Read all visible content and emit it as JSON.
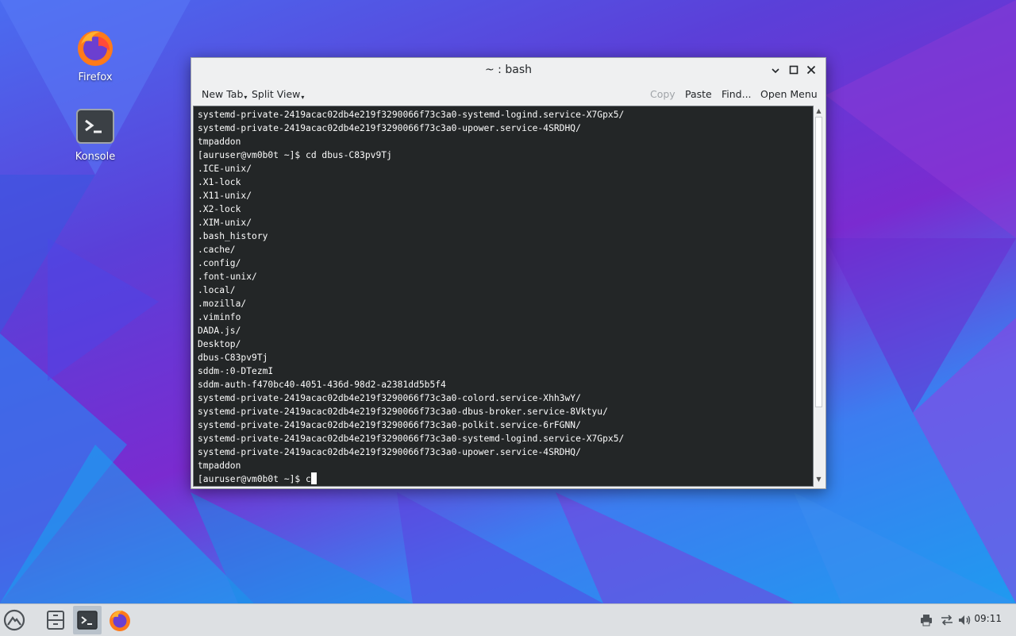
{
  "desktop": {
    "icons": [
      {
        "label": "Firefox",
        "icon": "firefox-icon"
      },
      {
        "label": "Konsole",
        "icon": "konsole-icon"
      }
    ]
  },
  "window": {
    "title": "~ : bash",
    "toolbar": {
      "new_tab": "New Tab",
      "split_view": "Split View",
      "copy": "Copy",
      "paste": "Paste",
      "find": "Find...",
      "open_menu": "Open Menu"
    },
    "terminal": {
      "lines": [
        "systemd-private-2419acac02db4e219f3290066f73c3a0-systemd-logind.service-X7Gpx5/",
        "systemd-private-2419acac02db4e219f3290066f73c3a0-upower.service-4SRDHQ/",
        "tmpaddon",
        "[auruser@vm0b0t ~]$ cd dbus-C83pv9Tj",
        ".ICE-unix/",
        ".X1-lock",
        ".X11-unix/",
        ".X2-lock",
        ".XIM-unix/",
        ".bash_history",
        ".cache/",
        ".config/",
        ".font-unix/",
        ".local/",
        ".mozilla/",
        ".viminfo",
        "DADA.js/",
        "Desktop/",
        "dbus-C83pv9Tj",
        "sddm-:0-DTezmI",
        "sddm-auth-f470bc40-4051-436d-98d2-a2381dd5b5f4",
        "systemd-private-2419acac02db4e219f3290066f73c3a0-colord.service-Xhh3wY/",
        "systemd-private-2419acac02db4e219f3290066f73c3a0-dbus-broker.service-8Vktyu/",
        "systemd-private-2419acac02db4e219f3290066f73c3a0-polkit.service-6rFGNN/",
        "systemd-private-2419acac02db4e219f3290066f73c3a0-systemd-logind.service-X7Gpx5/",
        "systemd-private-2419acac02db4e219f3290066f73c3a0-upower.service-4SRDHQ/",
        "tmpaddon"
      ],
      "prompt": "[auruser@vm0b0t ~]$ ",
      "input": "c"
    }
  },
  "taskbar": {
    "clock": "09:11",
    "items": [
      "app-launcher-icon",
      "file-manager-icon",
      "konsole-icon",
      "firefox-icon"
    ],
    "tray": [
      "printer-icon",
      "network-icon",
      "volume-icon"
    ]
  },
  "colors": {
    "terminal_bg": "#232627",
    "terminal_fg": "#fcfcfc",
    "window_bg": "#eff0f1",
    "taskbar_bg": "#dde0e3"
  }
}
